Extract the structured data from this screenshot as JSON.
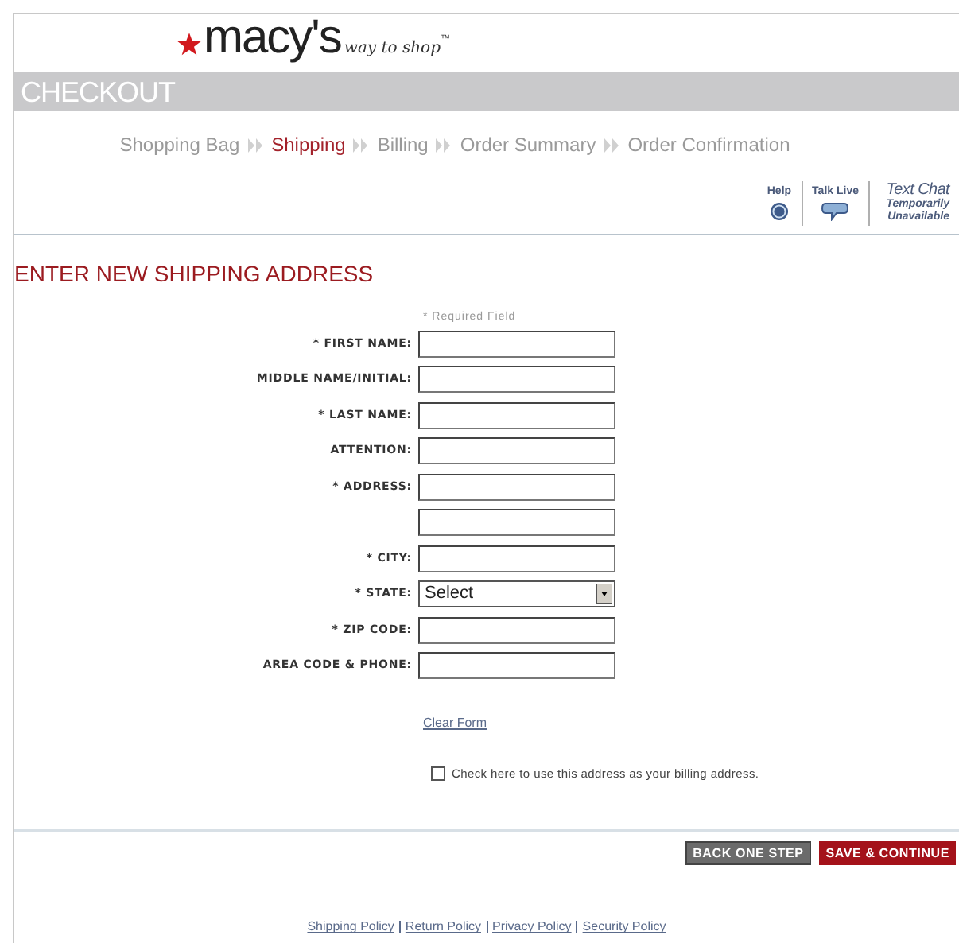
{
  "logo": {
    "brand": "macy's",
    "tagline": "way to shop",
    "tm": "™"
  },
  "checkout_bar": {
    "title": "CHECKOUT"
  },
  "steps": [
    {
      "label": "Shopping Bag",
      "selected": false
    },
    {
      "label": "Shipping",
      "selected": true
    },
    {
      "label": "Billing",
      "selected": false
    },
    {
      "label": "Order Summary",
      "selected": false
    },
    {
      "label": "Order Confirmation",
      "selected": false
    }
  ],
  "help_tools": {
    "help": "Help",
    "talk_live": "Talk Live",
    "text_chat": "Text Chat",
    "text_chat_status": "Temporarily Unavailable"
  },
  "heading": "ENTER NEW SHIPPING ADDRESS",
  "required_note": "* Required Field",
  "fields": [
    {
      "label": "* FIRST NAME:",
      "kind": "text"
    },
    {
      "label": "MIDDLE NAME/INITIAL:",
      "kind": "text"
    },
    {
      "label": "* LAST NAME:",
      "kind": "text"
    },
    {
      "label": "ATTENTION:",
      "kind": "text"
    },
    {
      "label": "* ADDRESS:",
      "kind": "text"
    },
    {
      "kind": "text"
    },
    {
      "label": "* CITY:",
      "kind": "text"
    },
    {
      "label": "* STATE:",
      "kind": "select",
      "value": "Select"
    },
    {
      "label": "* ZIP CODE:",
      "kind": "text"
    },
    {
      "label": "AREA CODE & PHONE:",
      "kind": "text"
    }
  ],
  "clear_form": "Clear Form",
  "billing_checkbox": {
    "label": "Check here to use this address as your billing address.",
    "checked": false
  },
  "buttons": [
    {
      "label": "BACK ONE STEP",
      "kind": "secondary"
    },
    {
      "label": "SAVE & CONTINUE",
      "kind": "primary"
    }
  ],
  "footer_links": [
    "Shipping Policy",
    "Return Policy",
    "Privacy Policy",
    "Security Policy"
  ]
}
